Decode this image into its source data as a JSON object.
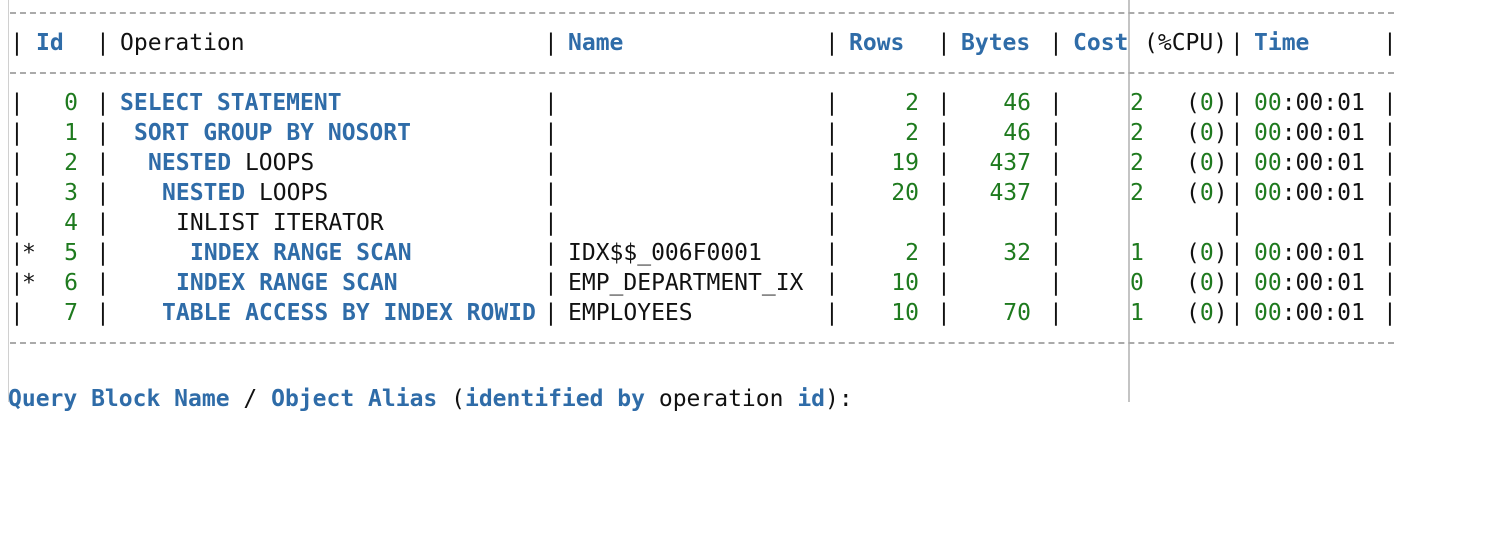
{
  "header": {
    "id": "Id",
    "operation": "Operation",
    "name": "Name",
    "rows": "Rows",
    "bytes": "Bytes",
    "cost": "Cost",
    "cpu": "(%CPU)",
    "time": "Time"
  },
  "plan_rows": [
    {
      "pred": "",
      "id": "0",
      "op_kw": "SELECT STATEMENT",
      "op_rest": "",
      "indent": 0,
      "name": "",
      "rows": "2",
      "bytes": "46",
      "cost": "2",
      "cpu": "0",
      "time_a": "00",
      "time_b": ":00:01"
    },
    {
      "pred": "",
      "id": "1",
      "op_kw": "SORT GROUP BY NOSORT",
      "op_rest": "",
      "indent": 1,
      "name": "",
      "rows": "2",
      "bytes": "46",
      "cost": "2",
      "cpu": "0",
      "time_a": "00",
      "time_b": ":00:01"
    },
    {
      "pred": "",
      "id": "2",
      "op_kw": "NESTED",
      "op_rest": " LOOPS",
      "indent": 2,
      "name": "",
      "rows": "19",
      "bytes": "437",
      "cost": "2",
      "cpu": "0",
      "time_a": "00",
      "time_b": ":00:01"
    },
    {
      "pred": "",
      "id": "3",
      "op_kw": "NESTED",
      "op_rest": " LOOPS",
      "indent": 3,
      "name": "",
      "rows": "20",
      "bytes": "437",
      "cost": "2",
      "cpu": "0",
      "time_a": "00",
      "time_b": ":00:01"
    },
    {
      "pred": "",
      "id": "4",
      "op_kw": "",
      "op_rest": "INLIST ITERATOR",
      "indent": 4,
      "name": "",
      "rows": "",
      "bytes": "",
      "cost": "",
      "cpu": "",
      "time_a": "",
      "time_b": ""
    },
    {
      "pred": "*",
      "id": "5",
      "op_kw": "INDEX RANGE SCAN",
      "op_rest": "",
      "indent": 5,
      "name": "IDX$$_006F0001",
      "rows": "2",
      "bytes": "32",
      "cost": "1",
      "cpu": "0",
      "time_a": "00",
      "time_b": ":00:01"
    },
    {
      "pred": "*",
      "id": "6",
      "op_kw": "INDEX RANGE SCAN",
      "op_rest": "",
      "indent": 4,
      "name": "EMP_DEPARTMENT_IX",
      "rows": "10",
      "bytes": "",
      "cost": "0",
      "cpu": "0",
      "time_a": "00",
      "time_b": ":00:01"
    },
    {
      "pred": "",
      "id": "7",
      "op_kw": "TABLE ACCESS BY INDEX ROWID",
      "op_rest": "",
      "indent": 3,
      "name": "EMPLOYEES",
      "rows": "10",
      "bytes": "70",
      "cost": "1",
      "cpu": "0",
      "time_a": "00",
      "time_b": ":00:01"
    }
  ],
  "footer": {
    "kw1": "Query Block Name",
    "sep": " / ",
    "kw2": "Object Alias",
    "open": " (",
    "kw3": "identified by",
    "mid": " operation ",
    "kw4": "id",
    "close": "):"
  }
}
